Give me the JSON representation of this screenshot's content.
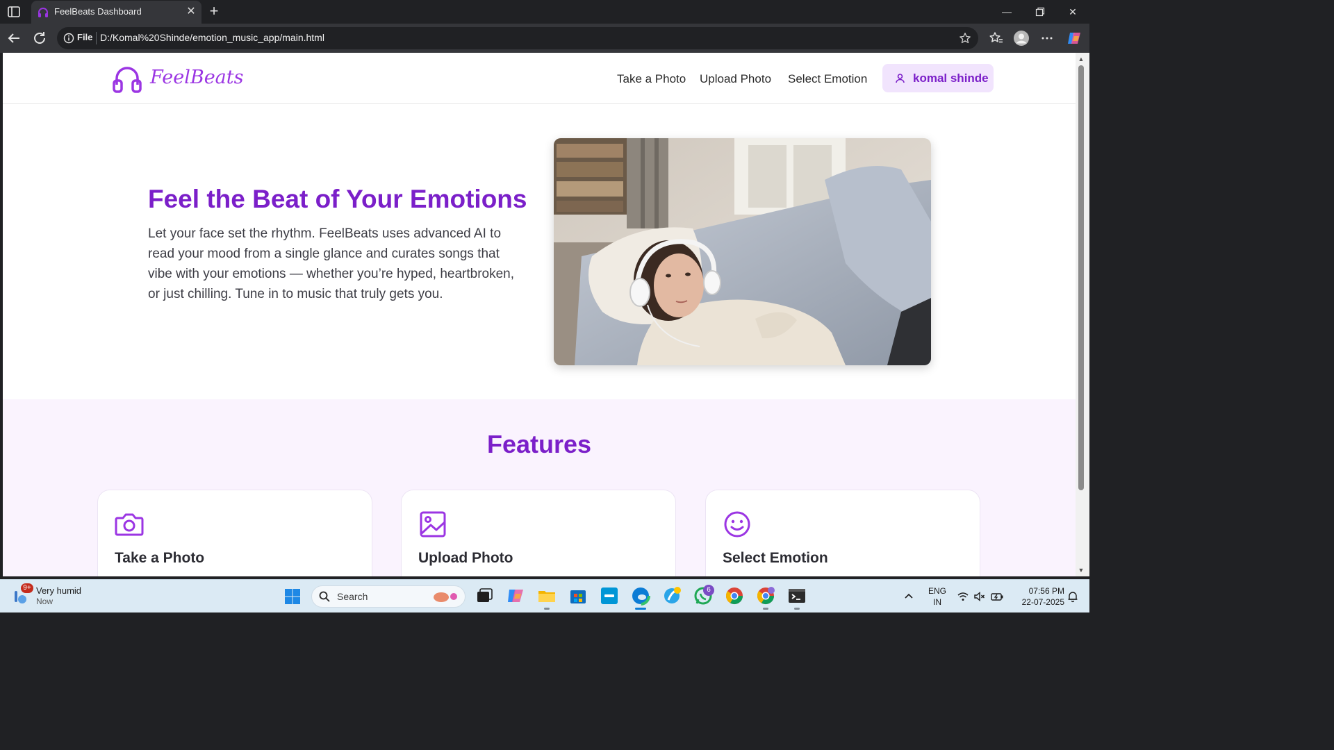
{
  "browser": {
    "tab_title": "FeelBeats Dashboard",
    "address_label": "File",
    "url": "D:/Komal%20Shinde/emotion_music_app/main.html"
  },
  "site": {
    "logo_text": "FeelBeats",
    "nav": [
      "Take a Photo",
      "Upload Photo",
      "Select Emotion"
    ],
    "user_name": "komal shinde",
    "accent_color": "#7b1fc9",
    "hero": {
      "title": "Feel the Beat of Your Emotions",
      "description": "Let your face set the rhythm. FeelBeats uses advanced AI to read your mood from a single glance and curates songs that vibe with your emotions — whether you’re hyped, heartbroken, or just chilling. Tune in to music that truly gets you."
    },
    "features": {
      "title": "Features",
      "cards": [
        {
          "title": "Take a Photo",
          "icon": "camera-icon"
        },
        {
          "title": "Upload Photo",
          "icon": "image-icon"
        },
        {
          "title": "Select Emotion",
          "icon": "smiley-icon"
        }
      ]
    }
  },
  "taskbar": {
    "weather_badge": "9+",
    "weather_title": "Very humid",
    "weather_sub": "Now",
    "search_placeholder": "Search",
    "whatsapp_badge": "6",
    "lang_line1": "ENG",
    "lang_line2": "IN",
    "time": "07:56 PM",
    "date": "22-07-2025"
  }
}
